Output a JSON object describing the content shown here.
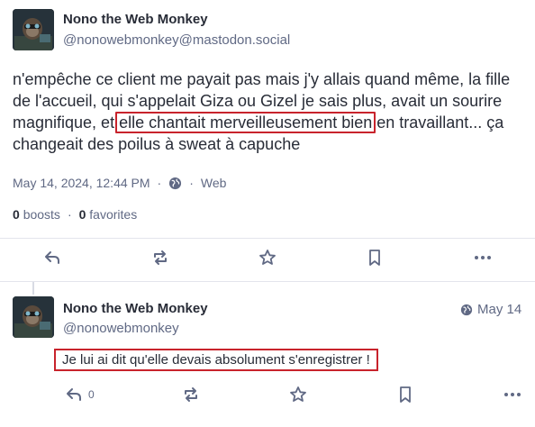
{
  "post": {
    "display_name": "Nono the Web Monkey",
    "handle": "@nonowebmonkey@mastodon.social",
    "content_before": "n'empêche ce client me payait pas mais j'y allais quand même, la fille de l'accueil, qui s'appelait Giza ou Gizel je sais plus, avait un sourire magnifique, et ",
    "content_highlight": "elle chantait merveilleusement bien",
    "content_after": " en travaillant... ça changeait des poilus à sweat à capuche",
    "timestamp": "May 14, 2024, 12:44 PM",
    "separator": "·",
    "visibility_icon": "globe-icon",
    "app": "Web",
    "boosts_count": "0",
    "boosts_label": "boosts",
    "favorites_count": "0",
    "favorites_label": "favorites"
  },
  "reply": {
    "display_name": "Nono the Web Monkey",
    "handle": "@nonowebmonkey",
    "date": "May 14",
    "visibility_icon": "globe-icon",
    "content": "Je lui ai dit qu'elle devais absolument s'enregistrer !",
    "reply_count": "0"
  },
  "colors": {
    "highlight_border": "#c8232c",
    "text": "#282c37",
    "secondary": "#606984"
  }
}
